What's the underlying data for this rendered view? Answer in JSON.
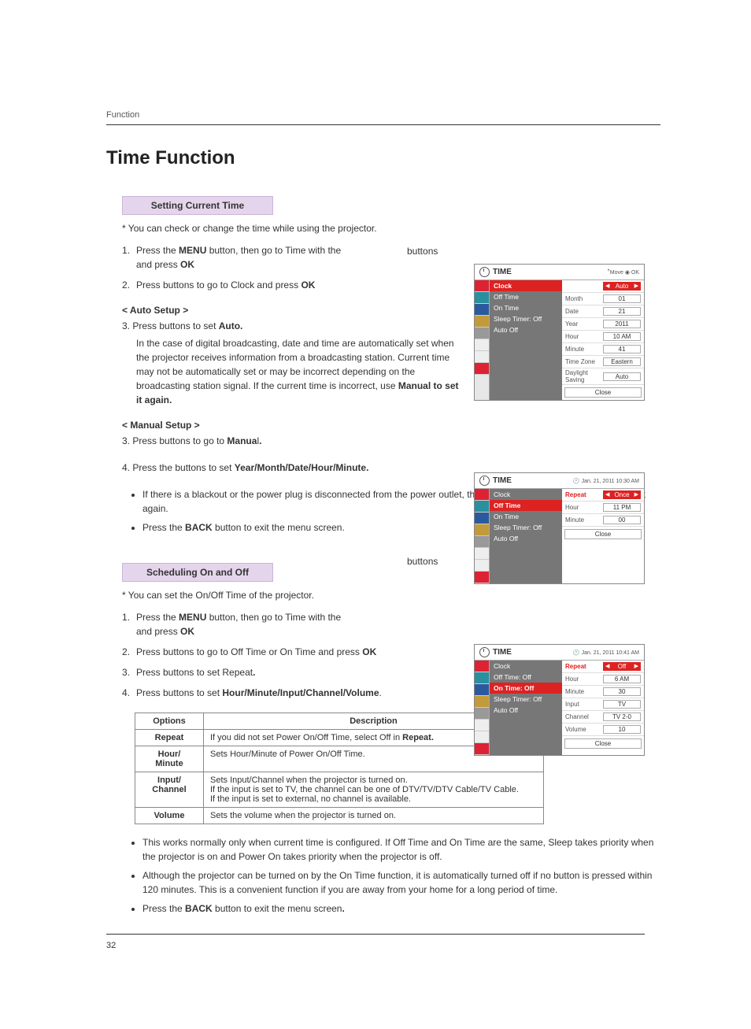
{
  "header": {
    "section": "Function"
  },
  "title": "Time Function",
  "pageNumber": "32",
  "section1": {
    "heading": "Setting Current Time",
    "note": "* You can check or change the time while using the projector.",
    "steps": [
      "Press the <b>MENU</b> button, then go to Time with the",
      "Press           buttons to go to Clock and press <b>OK</b>"
    ],
    "step1Tail": "and press <b>OK</b>",
    "buttonsWord": "buttons",
    "autoHead": "< Auto Setup >",
    "autoStep": "3.  Press           buttons to set <b>Auto.</b>",
    "autoBody": "In the case of digital broadcasting, date and time are automatically set when the projector receives information from a broadcasting station. Current time may not be automatically set or may be incorrect depending on the broadcasting station signal. If the current time is incorrect, use <b>Manual to set it again.</b>",
    "manualHead": "< Manual Setup >",
    "manualStep": "3.  Press           buttons to go to <b>Manua</b>l<b>.</b>",
    "step4": "4.  Press the                   buttons to set <b>Year/Month/Date/Hour/Minute.</b>",
    "bullets": [
      "If there is a blackout or the power plug is disconnected from the power outlet, the current time is deleted and must be set again.",
      "Press the <b>BACK</b> button to exit the menu screen."
    ]
  },
  "section2": {
    "heading": "Scheduling On and Off",
    "note": "* You can set the On/Off Time of the projector.",
    "steps": [
      "Press the <b>MENU</b> button, then go to Time with the",
      "Press           buttons to go to Off Time or On Time and press <b>OK</b>",
      "Press                   buttons to set Repeat<b>.</b>",
      "Press                   buttons to set <b>Hour/Minute/Input/Channel/Volume</b>."
    ],
    "step1Tail": "and press <b>OK</b>",
    "buttonsWord": "buttons",
    "table": {
      "headers": [
        "Options",
        "Description"
      ],
      "rows": [
        [
          "Repeat",
          "If you did not set Power On/Off Time, select Off in <b>Repeat.</b>"
        ],
        [
          "Hour/<br>Minute",
          "Sets Hour/Minute of Power On/Off Time."
        ],
        [
          "Input/<br>Channel",
          "Sets Input/Channel when the projector is turned on.<br>If the input is set to TV, the channel can be one of DTV/TV/DTV Cable/TV Cable.<br>If the input is set to external, no channel is available."
        ],
        [
          "Volume",
          "Sets the volume when the projector is turned on."
        ]
      ]
    },
    "bullets": [
      "This works normally only when current time is configured. If Off Time and On Time are the same, Sleep takes priority when the projector is on and Power On takes priority when the projector is off.",
      "Although the projector can be turned on by the On Time function, it is automatically turned off if no button is pressed within 120 minutes. This is a convenient function if you are away from your home for a long period of time.",
      "Press the <b>BACK</b> button to exit the menu screen<b>.</b>"
    ]
  },
  "osd1": {
    "title": "TIME",
    "hint": "ꜛMove ◉ OK",
    "menu": [
      "Clock",
      "Off Time",
      "On Time",
      "Sleep Timer: Off",
      "Auto Off"
    ],
    "sel": 0,
    "rows": [
      {
        "label": "",
        "value": "Auto",
        "sel": true
      },
      {
        "label": "Month",
        "value": "01"
      },
      {
        "label": "Date",
        "value": "21"
      },
      {
        "label": "Year",
        "value": "2011"
      },
      {
        "label": "Hour",
        "value": "10 AM"
      },
      {
        "label": "Minute",
        "value": "41"
      },
      {
        "label": "Time Zone",
        "value": "Eastern"
      },
      {
        "label": "Daylight Saving",
        "value": "Auto"
      }
    ],
    "close": "Close"
  },
  "osd2": {
    "title": "TIME",
    "hint": "🕐 Jan. 21, 2011 10:30 AM",
    "menu": [
      "Clock",
      "Off Time",
      "On Time",
      "Sleep Timer: Off",
      "Auto Off"
    ],
    "sel": 1,
    "rows": [
      {
        "label": "Repeat",
        "value": "Once",
        "sel": true
      },
      {
        "label": "Hour",
        "value": "11 PM"
      },
      {
        "label": "Minute",
        "value": "00"
      }
    ],
    "close": "Close"
  },
  "osd3": {
    "title": "TIME",
    "hint": "🕐 Jan. 21, 2011 10:41 AM",
    "menu": [
      "Clock",
      "Off Time: Off",
      "On Time: Off",
      "Sleep Timer: Off",
      "Auto Off"
    ],
    "sel": 2,
    "rows": [
      {
        "label": "Repeat",
        "value": "Off",
        "sel": true
      },
      {
        "label": "Hour",
        "value": "6 AM"
      },
      {
        "label": "Minute",
        "value": "30"
      },
      {
        "label": "Input",
        "value": "TV"
      },
      {
        "label": "Channel",
        "value": "TV 2-0"
      },
      {
        "label": "Volume",
        "value": "10"
      }
    ],
    "close": "Close"
  }
}
